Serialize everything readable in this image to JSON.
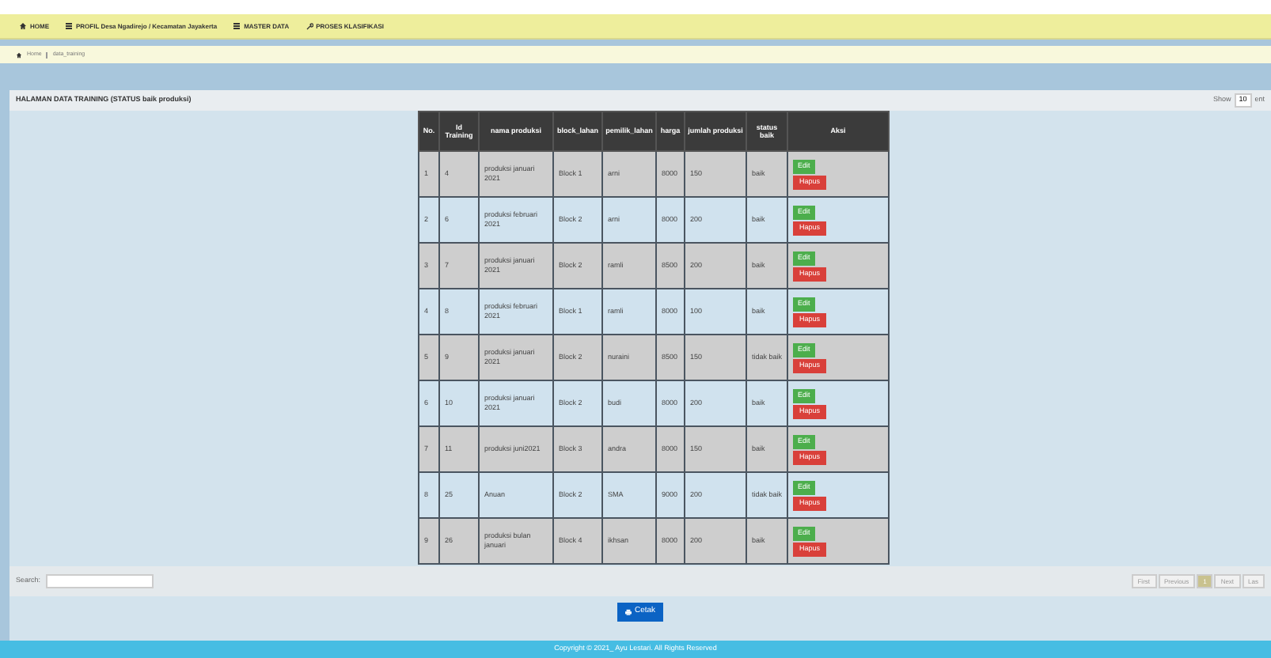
{
  "nav": [
    {
      "label": "HOME"
    },
    {
      "label": "PROFIL Desa Ngadirejo / Kecamatan Jayakerta"
    },
    {
      "label": "MASTER DATA"
    },
    {
      "label": "PROSES KLASIFIKASI"
    }
  ],
  "breadcrumb": [
    "Home",
    "data_training"
  ],
  "panel_title": "HALAMAN DATA TRAINING (STATUS baik produksi)",
  "length_menu": {
    "label": "Show",
    "value": "10",
    "suffix": "ent"
  },
  "table": {
    "columns": [
      "No.",
      "Id Training",
      "nama produksi",
      "block_lahan",
      "pemilik_lahan",
      "harga",
      "jumlah produksi",
      "status baik",
      "Aksi"
    ],
    "rows": [
      {
        "cells": [
          "1",
          "4",
          "produksi januari 2021",
          "Block 1",
          "arni",
          "8000",
          "150",
          "baik"
        ],
        "edit": "Edit",
        "delete": "Hapus"
      },
      {
        "cells": [
          "2",
          "6",
          "produksi februari 2021",
          "Block 2",
          "arni",
          "8000",
          "200",
          "baik"
        ],
        "edit": "Edit",
        "delete": "Hapus"
      },
      {
        "cells": [
          "3",
          "7",
          "produksi januari 2021",
          "Block 2",
          "ramli",
          "8500",
          "200",
          "baik"
        ],
        "edit": "Edit",
        "delete": "Hapus"
      },
      {
        "cells": [
          "4",
          "8",
          "produksi februari 2021",
          "Block 1",
          "ramli",
          "8000",
          "100",
          "baik"
        ],
        "edit": "Edit",
        "delete": "Hapus"
      },
      {
        "cells": [
          "5",
          "9",
          "produksi januari 2021",
          "Block 2",
          "nuraini",
          "8500",
          "150",
          "tidak baik"
        ],
        "edit": "Edit",
        "delete": "Hapus"
      },
      {
        "cells": [
          "6",
          "10",
          "produksi januari 2021",
          "Block 2",
          "budi",
          "8000",
          "200",
          "baik"
        ],
        "edit": "Edit",
        "delete": "Hapus"
      },
      {
        "cells": [
          "7",
          "11",
          "produksi juni2021",
          "Block 3",
          "andra",
          "8000",
          "150",
          "baik"
        ],
        "edit": "Edit",
        "delete": "Hapus"
      },
      {
        "cells": [
          "8",
          "25",
          "Anuan",
          "Block 2",
          "SMA",
          "9000",
          "200",
          "tidak baik"
        ],
        "edit": "Edit",
        "delete": "Hapus"
      },
      {
        "cells": [
          "9",
          "26",
          "produksi bulan januari",
          "Block 4",
          "ikhsan",
          "8000",
          "200",
          "baik"
        ],
        "edit": "Edit",
        "delete": "Hapus"
      }
    ]
  },
  "search": {
    "label": "Search:"
  },
  "pagination": [
    {
      "label": "First",
      "selected": false
    },
    {
      "label": "Previous",
      "selected": false
    },
    {
      "label": "1",
      "selected": true
    },
    {
      "label": "Next",
      "selected": false
    },
    {
      "label": "Las",
      "selected": false
    }
  ],
  "print_button": "Cetak",
  "footer": "Copyright © 2021_ Ayu Lestari. All Rights Reserved"
}
